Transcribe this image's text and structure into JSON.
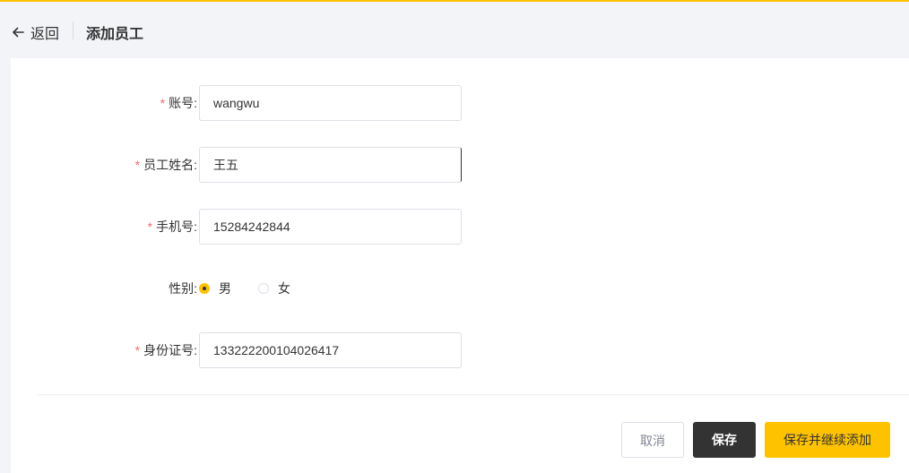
{
  "header": {
    "back_label": "返回",
    "title": "添加员工"
  },
  "form": {
    "required_mark": "*",
    "account": {
      "label": "账号:",
      "value": "wangwu"
    },
    "name": {
      "label": "员工姓名:",
      "value": "王五"
    },
    "phone": {
      "label": "手机号:",
      "value": "15284242844"
    },
    "gender": {
      "label": "性别:",
      "options": [
        "男",
        "女"
      ],
      "selected": "男"
    },
    "id_number": {
      "label": "身份证号:",
      "value": "133222200104026417"
    }
  },
  "actions": {
    "cancel": "取消",
    "save": "保存",
    "save_continue": "保存并继续添加"
  },
  "colors": {
    "accent": "#ffc200",
    "dark": "#333333",
    "required": "#f56c6c"
  }
}
